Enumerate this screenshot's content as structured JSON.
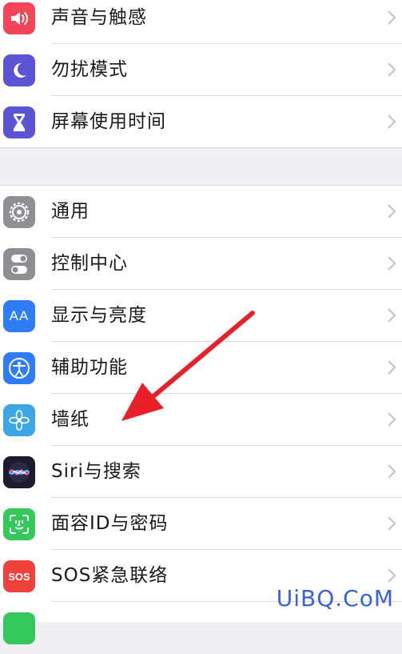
{
  "colors": {
    "sound": "#f2455a",
    "dnd": "#5b55d6",
    "screen_time": "#5b55d6",
    "general": "#8e8e93",
    "control_center": "#8e8e93",
    "display": "#2f7df6",
    "accessibility": "#2f7df6",
    "wallpaper": "#3ca6e6",
    "siri": "#1c1c2e",
    "face_id": "#34c759",
    "sos": "#f0423a",
    "arrow": "#e8202a",
    "watermark": "#3a63d8"
  },
  "group1": {
    "items": [
      {
        "label": "声音与触感",
        "icon": "speaker-icon"
      },
      {
        "label": "勿扰模式",
        "icon": "moon-icon"
      },
      {
        "label": "屏幕使用时间",
        "icon": "hourglass-icon"
      }
    ]
  },
  "group2": {
    "items": [
      {
        "label": "通用",
        "icon": "gear-icon"
      },
      {
        "label": "控制中心",
        "icon": "toggles-icon"
      },
      {
        "label": "显示与亮度",
        "icon": "aa-icon",
        "icon_text": "AA"
      },
      {
        "label": "辅助功能",
        "icon": "accessibility-icon"
      },
      {
        "label": "墙纸",
        "icon": "flower-icon"
      },
      {
        "label": "Siri与搜索",
        "icon": "siri-icon"
      },
      {
        "label": "面容ID与密码",
        "icon": "face-id-icon"
      },
      {
        "label": "SOS紧急联络",
        "icon": "sos-icon",
        "icon_text": "SOS"
      }
    ]
  },
  "watermark": "UiBQ.CoM"
}
